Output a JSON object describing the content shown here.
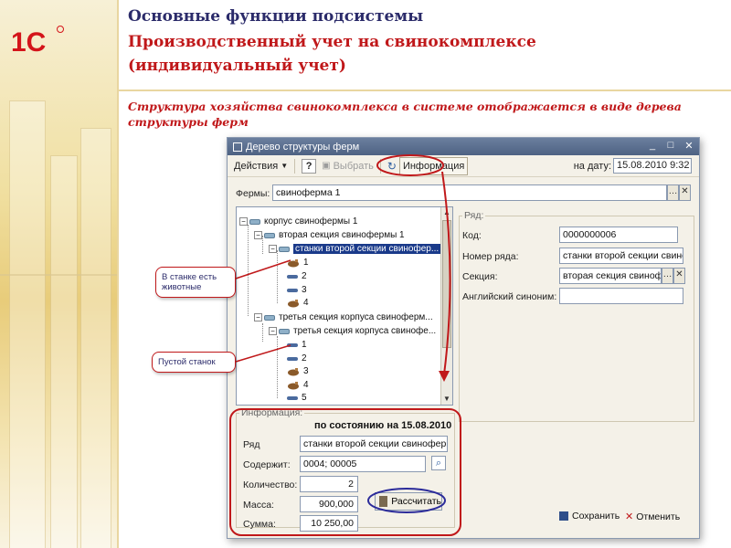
{
  "slide": {
    "title_line1": "Основные функции подсистемы",
    "title_line2": "Производственный учет на свинокомплексе",
    "title_line3": "(индивидуальный учет)",
    "subtitle": "Структура хозяйства свинокомплекса в системе отображается в виде дерева структуры ферм",
    "logo_text": "1С"
  },
  "window": {
    "title": "Дерево структуры ферм",
    "toolbar": {
      "actions": "Действия",
      "help": "?",
      "select": "Выбрать",
      "info": "Информация",
      "date_label": "на дату:",
      "date_value": "15.08.2010  9:32"
    },
    "farms_label": "Фермы:",
    "farms_value": "свиноферма 1",
    "tree": [
      {
        "label": "корпус свинофермы 1"
      },
      {
        "label": "вторая секция свинофермы 1"
      },
      {
        "label": "станки второй секции свинофер..."
      },
      {
        "label": "1"
      },
      {
        "label": "2"
      },
      {
        "label": "3"
      },
      {
        "label": "4"
      },
      {
        "label": "третья секция корпуса свиноферм..."
      },
      {
        "label": "третья секция корпуса свинофе..."
      },
      {
        "label": "1"
      },
      {
        "label": "2"
      },
      {
        "label": "3"
      },
      {
        "label": "4"
      },
      {
        "label": "5"
      }
    ],
    "row_panel": {
      "group_title": "Ряд:",
      "code_label": "Код:",
      "code_value": "0000000006",
      "row_no_label": "Номер ряда:",
      "row_no_value": "станки второй секции свинофермы",
      "section_label": "Секция:",
      "section_value": "вторая секция свинофе",
      "english_label": "Английский синоним:",
      "english_value": ""
    },
    "info_panel": {
      "group_title": "Информация:",
      "as_of": "по состоянию на 15.08.2010",
      "row_label": "Ряд",
      "row_value": "станки второй секции свинофермы",
      "contents_label": "Содержит:",
      "contents_value": "0004; 00005",
      "qty_label": "Количество:",
      "qty_value": "2",
      "mass_label": "Масса:",
      "mass_value": "900,000",
      "sum_label": "Сумма:",
      "sum_value": "10 250,00",
      "calc_button": "Рассчитать"
    },
    "save_button": "Сохранить",
    "cancel_button": "Отменить"
  },
  "callouts": {
    "animals": "В станке есть животные",
    "empty": "Пустой станок"
  },
  "colors": {
    "accent_red": "#c0181a",
    "title_navy": "#2b2b6a",
    "selection": "#1a3a8a"
  }
}
